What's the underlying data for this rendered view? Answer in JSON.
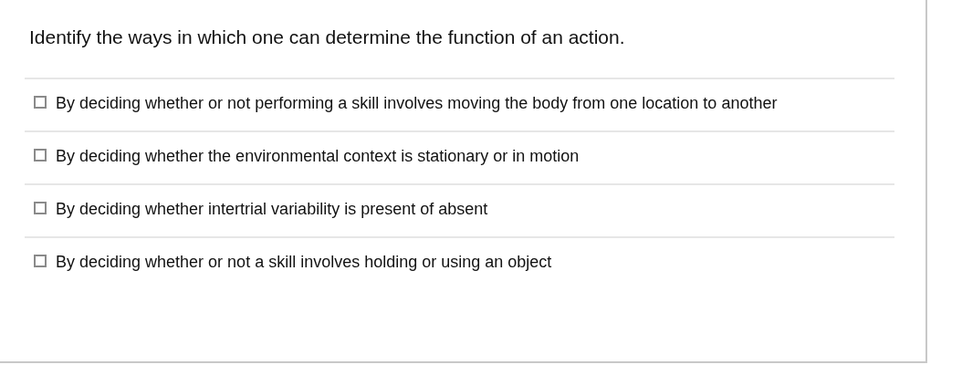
{
  "question": "Identify the ways in which one can determine the function of an action.",
  "options": [
    {
      "label": "By deciding whether or not performing a skill involves moving the body from one location to another",
      "checked": false
    },
    {
      "label": "By deciding whether the environmental context is stationary or in motion",
      "checked": false
    },
    {
      "label": "By deciding whether intertrial variability is present of absent",
      "checked": false
    },
    {
      "label": "By deciding whether or not a skill involves holding or using an object",
      "checked": false
    }
  ]
}
